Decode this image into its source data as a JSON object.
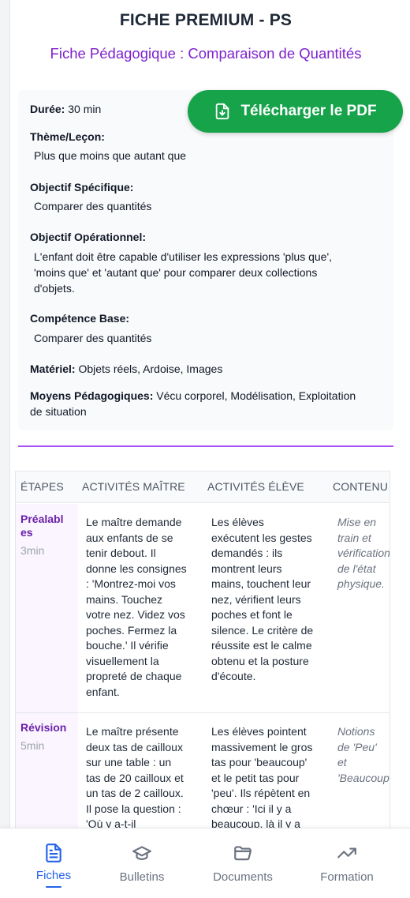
{
  "header": {
    "title": "FICHE PREMIUM - PS",
    "subtitle": "Fiche Pédagogique : Comparaison de Quantités"
  },
  "pdf_button": {
    "label": "Télécharger le PDF",
    "icon": "file-download-icon",
    "color": "#16a34a"
  },
  "info": {
    "duree_label": "Durée:",
    "duree_value": " 30 min",
    "theme_label": "Thème/Leçon:",
    "theme_value": "Plus que moins que autant que",
    "objectif_specifique_label": "Objectif Spécifique:",
    "objectif_specifique_value": "Comparer des quantités",
    "objectif_operationnel_label": "Objectif Opérationnel:",
    "objectif_operationnel_lines": [
      "L'enfant doit être capable d'utiliser les expressions 'plus que',",
      "'moins que' et 'autant que' pour comparer deux collections",
      "d'objets."
    ],
    "competence_label": "Compétence Base:",
    "competence_value": "Comparer des quantités",
    "materiel_label": "Matériel:",
    "materiel_value": " Objets réels, Ardoise, Images",
    "moyens_label": "Moyens Pédagogiques:",
    "moyens_value_line1": " Vécu corporel, Modélisation, Exploitation",
    "moyens_value_line2": "de situation"
  },
  "table": {
    "headers": [
      "ÉTAPES",
      "ACTIVITÉS MAÎTRE",
      "ACTIVITÉS ÉLÈVE",
      "CONTENU"
    ],
    "rows": [
      {
        "step_lines": [
          "Préalabl",
          "es"
        ],
        "time": "3min",
        "maitre": [
          "Le maître demande",
          "aux enfants de se",
          "tenir debout. Il",
          "donne les consignes",
          ": 'Montrez-moi vos",
          "mains. Touchez",
          "votre nez. Videz vos",
          "poches. Fermez la",
          "bouche.' Il vérifie",
          "visuellement la",
          "propreté de chaque",
          "enfant."
        ],
        "eleve": [
          "Les élèves",
          "exécutent les gestes",
          "demandés : ils",
          "montrent leurs",
          "mains, touchent leur",
          "nez, vérifient leurs",
          "poches et font le",
          "silence. Le critère de",
          "réussite est le calme",
          "obtenu et la posture",
          "d'écoute."
        ],
        "contenu": [
          "Mise en",
          "train et",
          "vérification",
          "de l'état",
          "physique."
        ]
      },
      {
        "step_lines": [
          "Révision"
        ],
        "time": "5min",
        "maitre": [
          "Le maître présente",
          "deux tas de cailloux",
          "sur une table : un",
          "tas de 20 cailloux et",
          "un tas de 2 cailloux.",
          "Il pose la question :",
          "'Où y a-t-il"
        ],
        "eleve": [
          "Les élèves pointent",
          "massivement le gros",
          "tas pour 'beaucoup'",
          "et le petit tas pour",
          "'peu'. Ils répètent en",
          "chœur : 'Ici il y a",
          "beaucoup, là il y a"
        ],
        "contenu": [
          "Notions",
          "de 'Peu'",
          "et",
          "'Beaucoup'"
        ]
      }
    ]
  },
  "nav": {
    "items": [
      {
        "label": "Fiches",
        "icon": "document-icon",
        "active": true
      },
      {
        "label": "Bulletins",
        "icon": "graduation-cap-icon",
        "active": false
      },
      {
        "label": "Documents",
        "icon": "folder-icon",
        "active": false
      },
      {
        "label": "Formation",
        "icon": "trending-up-icon",
        "active": false
      }
    ],
    "active_color": "#2563eb"
  }
}
